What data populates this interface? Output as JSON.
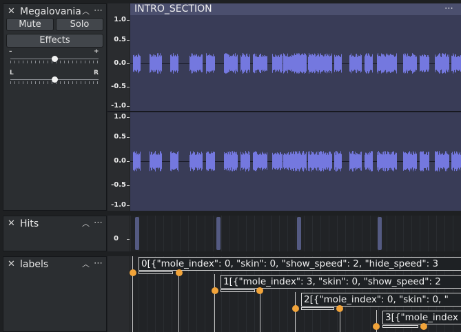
{
  "tracks": {
    "audio": {
      "name": "Megalovania",
      "mute_label": "Mute",
      "solo_label": "Solo",
      "effects_label": "Effects",
      "gain_min_label": "–",
      "gain_max_label": "+",
      "gain_level": 0.5,
      "pan_left_label": "L",
      "pan_right_label": "R",
      "pan_level": 0.5
    },
    "hits": {
      "name": "Hits",
      "scale_label": "0"
    },
    "labels": {
      "name": "labels"
    }
  },
  "clip": {
    "name": "INTRO_SECTION"
  },
  "amplitude_ruler": {
    "channel1": [
      "1.0",
      "0.5",
      "0.0",
      "-0.5",
      "-1.0"
    ],
    "channel2": [
      "1.0",
      "0.5",
      "0.0",
      "-0.5",
      "-1.0"
    ]
  },
  "label_items": [
    {
      "text": "0[{\"mole_index\": 0, \"skin\": 0, \"show_speed\": 2, \"hide_speed\": 3"
    },
    {
      "text": "1[{\"mole_index\": 3, \"skin\": 0, \"show_speed\": 2"
    },
    {
      "text": "2[{\"mole_index\": 0, \"skin\": 0, \""
    },
    {
      "text": "3[{\"mole_index"
    }
  ],
  "colors": {
    "waveform": "#7478df",
    "waveform_bg": "#393c57",
    "label_marker": "#f2a43a",
    "clip_header": "#4b4f6e"
  }
}
